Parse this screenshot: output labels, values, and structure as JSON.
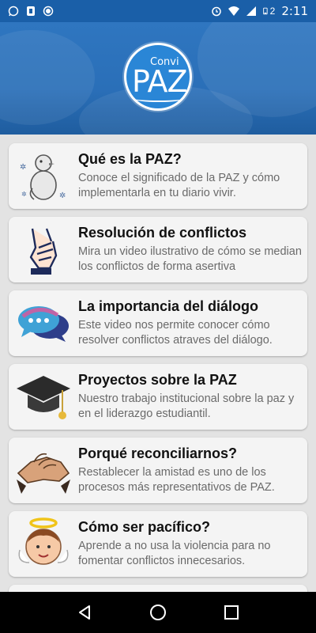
{
  "status_bar": {
    "time": "2:11",
    "battery_level": "2",
    "left_icons": [
      "whatsapp-icon",
      "phone-icon",
      "record-icon"
    ],
    "right_icons": [
      "alarm-icon",
      "wifi-icon",
      "signal-icon",
      "battery-icon"
    ]
  },
  "header": {
    "logo_small": "Convi",
    "logo_big": "PAZ",
    "bg_color": "#2a6fb8"
  },
  "items": [
    {
      "title": "Qué es la PAZ?",
      "description": "Conoce el significado de la PAZ y cómo implementarla en tu diario vivir.",
      "icon": "dove-icon"
    },
    {
      "title": "Resolución de conflictos",
      "description": "Mira un video ilustrativo de cómo se median los conflictos de forma asertiva",
      "icon": "handshake-icon"
    },
    {
      "title": "La importancia del diálogo",
      "description": "Este video nos permite conocer cómo resolver conflictos atraves del diálogo.",
      "icon": "chat-bubbles-icon"
    },
    {
      "title": "Proyectos sobre la PAZ",
      "description": "Nuestro trabajo institucional sobre la paz y en el liderazgo estudiantil.",
      "icon": "graduation-cap-icon"
    },
    {
      "title": "Porqué reconciliarnos?",
      "description": "Restablecer la amistad es uno de los procesos más representativos de PAZ.",
      "icon": "clasped-hands-icon"
    },
    {
      "title": "Cómo ser pacífico?",
      "description": "Aprende a no usa la violencia para no fomentar conflictos innecesarios.",
      "icon": "angel-icon"
    }
  ],
  "nav": {
    "buttons": [
      "back-icon",
      "home-icon",
      "recents-icon"
    ]
  }
}
